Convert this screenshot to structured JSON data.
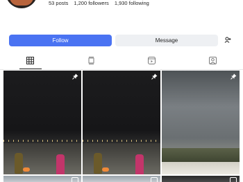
{
  "profile": {
    "stats": {
      "posts": "53 posts",
      "followers": "1,200 followers",
      "following": "1,930 following"
    }
  },
  "actions": {
    "follow_label": "Follow",
    "message_label": "Message",
    "suggest_icon": "add-person-icon"
  },
  "tabs": [
    {
      "icon": "grid-icon",
      "active": true
    },
    {
      "icon": "feed-icon",
      "active": false
    },
    {
      "icon": "reels-icon",
      "active": false
    },
    {
      "icon": "tagged-icon",
      "active": false
    }
  ],
  "colors": {
    "follow_button": "#4a73f2",
    "message_button": "#eef0f3",
    "text": "#262626"
  },
  "posts": [
    {
      "kind": "night-photo",
      "pinned": true
    },
    {
      "kind": "night-photo",
      "pinned": true
    },
    {
      "kind": "cloudy-sky-photo",
      "pinned": false
    },
    {
      "kind": "photo",
      "reel": true
    },
    {
      "kind": "photo",
      "reel": true
    },
    {
      "kind": "photo",
      "reel": true
    }
  ]
}
